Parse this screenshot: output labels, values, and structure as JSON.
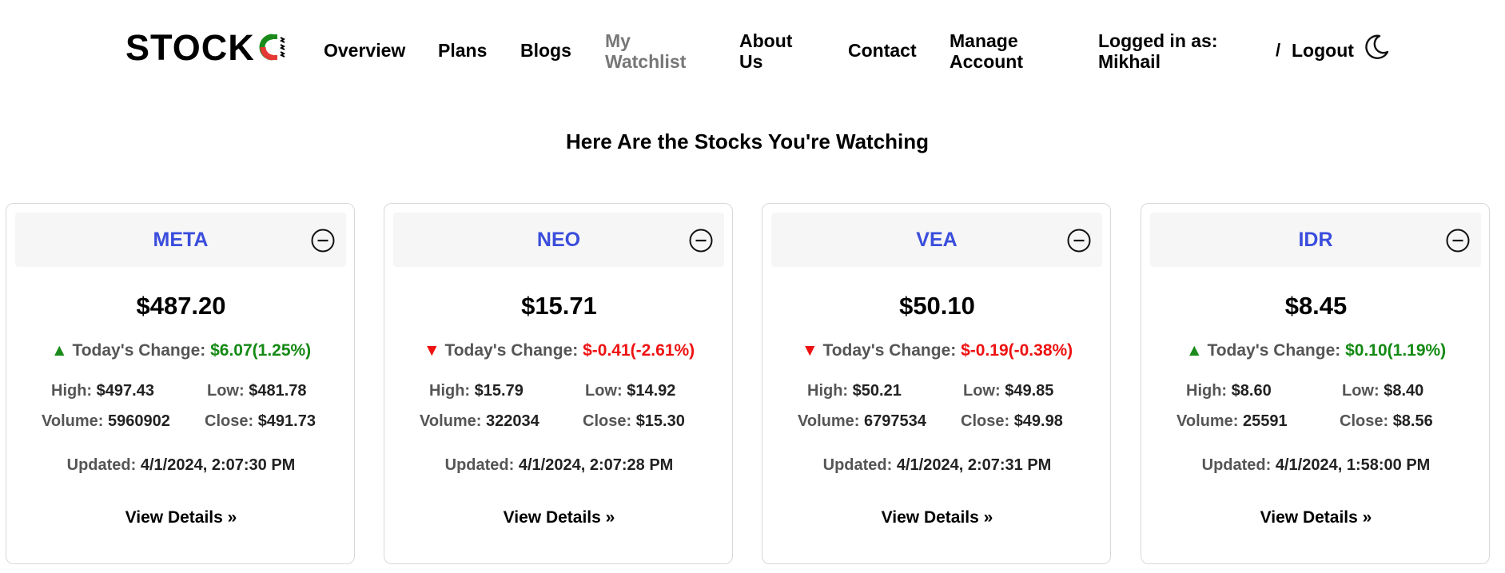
{
  "header": {
    "logo_text": "STOCK",
    "nav": [
      {
        "label": "Overview"
      },
      {
        "label": "Plans"
      },
      {
        "label": "Blogs"
      },
      {
        "label": "My Watchlist"
      },
      {
        "label": "About Us"
      },
      {
        "label": "Contact"
      },
      {
        "label": "Manage Account"
      }
    ],
    "logged_in": "Logged in as: Mikhail",
    "separator": "/",
    "logout": "Logout"
  },
  "title": "Here Are the Stocks You're Watching",
  "labels": {
    "change": "Today's Change:",
    "high": "High:",
    "low": "Low:",
    "volume": "Volume:",
    "close": "Close:",
    "updated": "Updated:",
    "details": "View Details »"
  },
  "colors": {
    "ticker": "#3a4ddc",
    "positive": "#138a13",
    "negative": "#ee1111",
    "active_nav": "#777777"
  },
  "icons": {
    "theme_toggle": "moon-icon",
    "remove": "minus-circle-icon",
    "up": "triangle-up-icon",
    "down": "triangle-down-icon"
  },
  "stocks": [
    {
      "ticker": "META",
      "price": "$487.20",
      "direction": "up",
      "arrow": "▲",
      "change": "$6.07(1.25%)",
      "high": "$497.43",
      "low": "$481.78",
      "volume": "5960902",
      "close": "$491.73",
      "updated": "4/1/2024, 2:07:30 PM"
    },
    {
      "ticker": "NEO",
      "price": "$15.71",
      "direction": "down",
      "arrow": "▼",
      "change": "$-0.41(-2.61%)",
      "high": "$15.79",
      "low": "$14.92",
      "volume": "322034",
      "close": "$15.30",
      "updated": "4/1/2024, 2:07:28 PM"
    },
    {
      "ticker": "VEA",
      "price": "$50.10",
      "direction": "down",
      "arrow": "▼",
      "change": "$-0.19(-0.38%)",
      "high": "$50.21",
      "low": "$49.85",
      "volume": "6797534",
      "close": "$49.98",
      "updated": "4/1/2024, 2:07:31 PM"
    },
    {
      "ticker": "IDR",
      "price": "$8.45",
      "direction": "up",
      "arrow": "▲",
      "change": "$0.10(1.19%)",
      "high": "$8.60",
      "low": "$8.40",
      "volume": "25591",
      "close": "$8.56",
      "updated": "4/1/2024, 1:58:00 PM"
    }
  ]
}
